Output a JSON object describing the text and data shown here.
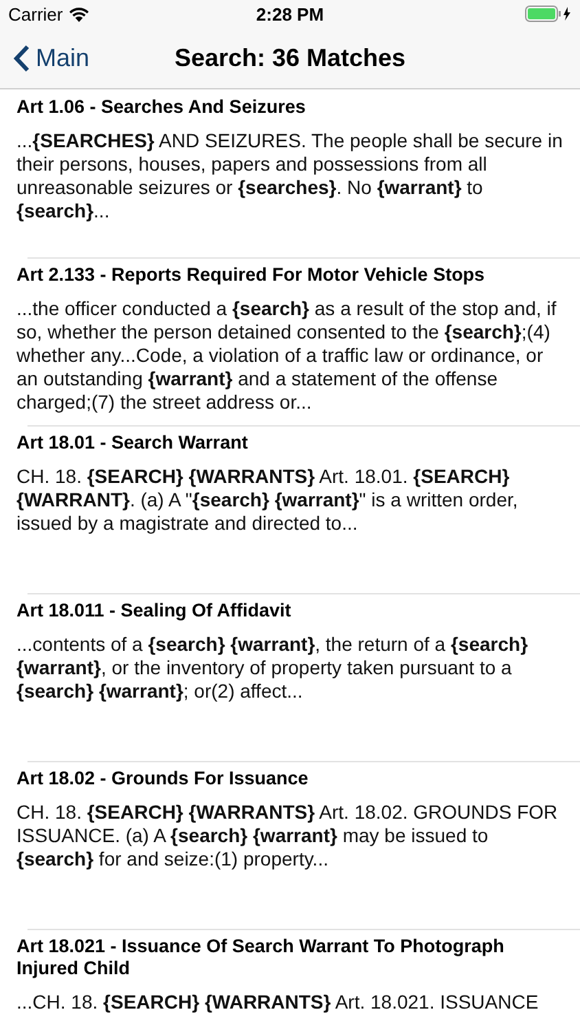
{
  "status_bar": {
    "carrier": "Carrier",
    "time": "2:28 PM"
  },
  "nav_bar": {
    "back_label": "Main",
    "title": "Search: 36 Matches"
  },
  "results": [
    {
      "title": "Art 1.06 - Searches And Seizures",
      "snippet": "...**{SEARCHES}** AND SEIZURES. The people shall be secure in their persons, houses, papers and possessions from all unreasonable seizures or **{searches}**. No **{warrant}** to **{search}**..."
    },
    {
      "title": "Art 2.133 - Reports Required For Motor Vehicle Stops",
      "snippet": "...the officer conducted a **{search}** as a result of the stop and, if so, whether the person detained consented to the **{search}**;(4) whether any...Code, a violation of a traffic law or ordinance, or an outstanding **{warrant}** and a statement of the offense charged;(7) the street address or..."
    },
    {
      "title": "Art 18.01 - Search Warrant",
      "snippet": "CH. 18. **{SEARCH}** **{WARRANTS}** Art. 18.01. **{SEARCH}** **{WARRANT}**. (a) A \"**{search}** **{warrant}**\" is a written order, issued by a magistrate and directed to..."
    },
    {
      "title": "Art 18.011 - Sealing Of Affidavit",
      "snippet": "...contents of a **{search}** **{warrant}**, the return of a **{search}** **{warrant}**, or the inventory of property taken pursuant to a **{search}** **{warrant}**; or(2) affect..."
    },
    {
      "title": "Art 18.02 - Grounds For Issuance",
      "snippet": "CH. 18. **{SEARCH}** **{WARRANTS}** Art. 18.02. GROUNDS FOR ISSUANCE. (a) A **{search}** **{warrant}** may be issued to **{search}** for and seize:(1) property..."
    },
    {
      "title": "Art 18.021 - Issuance Of Search Warrant To Photograph Injured Child",
      "snippet": "...CH. 18. **{SEARCH}** **{WARRANTS}** Art. 18.021. ISSUANCE"
    }
  ]
}
